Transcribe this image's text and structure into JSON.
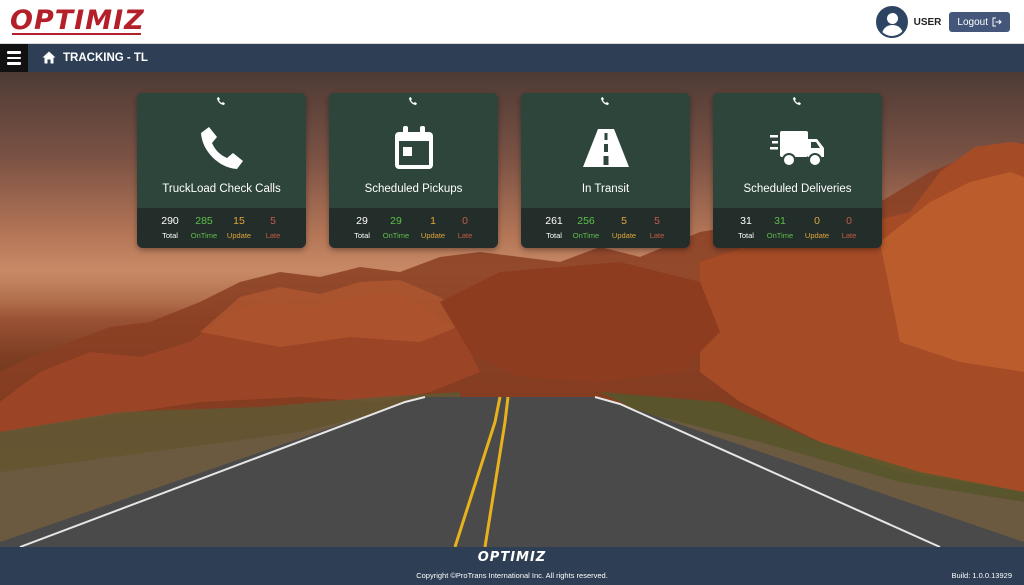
{
  "header": {
    "logo_text": "OPTIMIZ",
    "user_label": "USER",
    "logout_label": "Logout"
  },
  "nav": {
    "title": "TRACKING - TL"
  },
  "cards": [
    {
      "title": "TruckLoad Check Calls",
      "icon": "phone-icon",
      "stats": [
        {
          "value": "290",
          "label": "Total"
        },
        {
          "value": "285",
          "label": "OnTime"
        },
        {
          "value": "15",
          "label": "Update"
        },
        {
          "value": "5",
          "label": "Late"
        }
      ]
    },
    {
      "title": "Scheduled Pickups",
      "icon": "calendar-icon",
      "stats": [
        {
          "value": "29",
          "label": "Total"
        },
        {
          "value": "29",
          "label": "OnTime"
        },
        {
          "value": "1",
          "label": "Update"
        },
        {
          "value": "0",
          "label": "Late"
        }
      ]
    },
    {
      "title": "In Transit",
      "icon": "road-icon",
      "stats": [
        {
          "value": "261",
          "label": "Total"
        },
        {
          "value": "256",
          "label": "OnTime"
        },
        {
          "value": "5",
          "label": "Update"
        },
        {
          "value": "5",
          "label": "Late"
        }
      ]
    },
    {
      "title": "Scheduled Deliveries",
      "icon": "shipping-truck-icon",
      "stats": [
        {
          "value": "31",
          "label": "Total"
        },
        {
          "value": "31",
          "label": "OnTime"
        },
        {
          "value": "0",
          "label": "Update"
        },
        {
          "value": "0",
          "label": "Late"
        }
      ]
    }
  ],
  "footer": {
    "logo_text": "OPTIMIZ",
    "copyright": "Copyright ©ProTrans International Inc. All rights reserved.",
    "build": "Build: 1.0.0.13929"
  },
  "colors": {
    "brand_red": "#b3202a",
    "nav_bg": "#2d3e55",
    "ontime": "#5fbf4a",
    "update": "#e0a43a",
    "late": "#c85a45"
  }
}
